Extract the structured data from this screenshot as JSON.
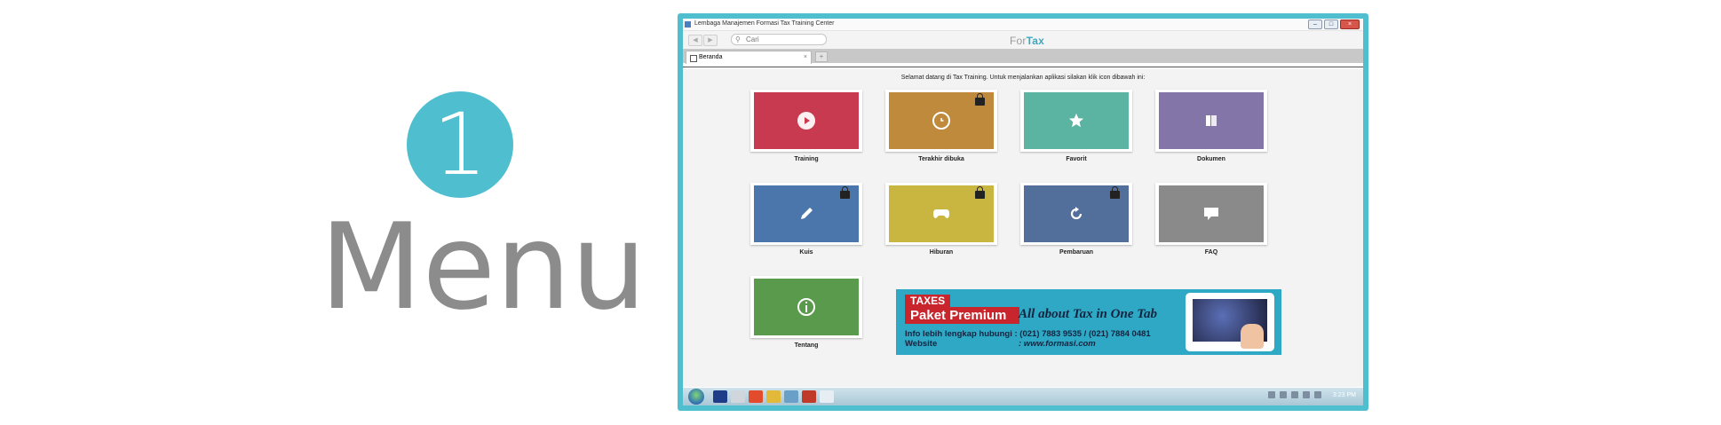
{
  "step": {
    "number": "1",
    "title": "Menu"
  },
  "window": {
    "title": "Lembaga Manajemen Formasi Tax Training Center",
    "buttons": {
      "minimize": "–",
      "maximize": "□",
      "close": "×"
    }
  },
  "toolbar": {
    "back": "◀",
    "forward": "▶",
    "search_placeholder": "Cari",
    "brand_part1": "For",
    "brand_part2": "Tax"
  },
  "tabs": [
    {
      "label": "Beranda",
      "close": "×"
    }
  ],
  "new_tab_label": "+",
  "main": {
    "welcome": "Selamat datang di Tax Training. Untuk menjalankan aplikasi silakan klik icon dibawah ini:"
  },
  "tiles": [
    {
      "label": "Training",
      "color": "#c83a50",
      "icon": "play-icon",
      "locked": false
    },
    {
      "label": "Terakhir dibuka",
      "color": "#c08a3c",
      "icon": "clock-icon",
      "locked": true
    },
    {
      "label": "Favorit",
      "color": "#5bb3a2",
      "icon": "star-icon",
      "locked": false
    },
    {
      "label": "Dokumen",
      "color": "#8475a8",
      "icon": "document-icon",
      "locked": false
    },
    {
      "label": "Kuis",
      "color": "#4a76ab",
      "icon": "pencil-icon",
      "locked": true
    },
    {
      "label": "Hiburan",
      "color": "#c8b640",
      "icon": "gamepad-icon",
      "locked": true
    },
    {
      "label": "Pembaruan",
      "color": "#526e9a",
      "icon": "refresh-icon",
      "locked": true
    },
    {
      "label": "FAQ",
      "color": "#8a8a8a",
      "icon": "chat-icon",
      "locked": false
    },
    {
      "label": "Tentang",
      "color": "#5a9a4c",
      "icon": "info-icon",
      "locked": false
    }
  ],
  "banner": {
    "line1": "TAXES",
    "line2": "Paket Premium",
    "tagline": "All about Tax in One Tab",
    "info_label": "Info lebih lengkap hubungi",
    "info_value": ": (021) 7883 9535 / (021) 7884 0481",
    "website_label": "Website",
    "website_value": ": www.formasi.com"
  },
  "taskbar": {
    "clock": "3:23 PM"
  }
}
